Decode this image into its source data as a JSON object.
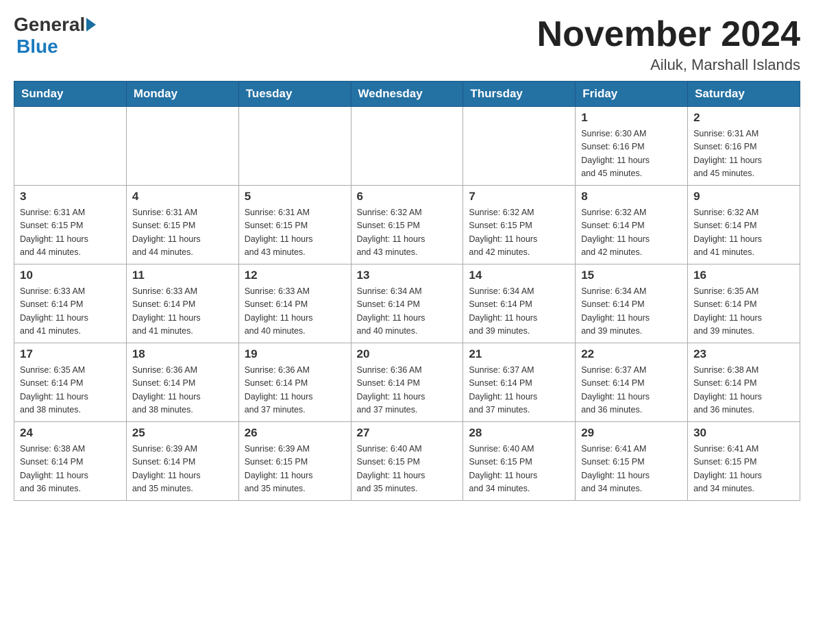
{
  "header": {
    "logo": {
      "general": "General",
      "blue": "Blue"
    },
    "title": "November 2024",
    "location": "Ailuk, Marshall Islands"
  },
  "weekdays": [
    "Sunday",
    "Monday",
    "Tuesday",
    "Wednesday",
    "Thursday",
    "Friday",
    "Saturday"
  ],
  "weeks": [
    [
      {
        "day": "",
        "info": ""
      },
      {
        "day": "",
        "info": ""
      },
      {
        "day": "",
        "info": ""
      },
      {
        "day": "",
        "info": ""
      },
      {
        "day": "",
        "info": ""
      },
      {
        "day": "1",
        "info": "Sunrise: 6:30 AM\nSunset: 6:16 PM\nDaylight: 11 hours\nand 45 minutes."
      },
      {
        "day": "2",
        "info": "Sunrise: 6:31 AM\nSunset: 6:16 PM\nDaylight: 11 hours\nand 45 minutes."
      }
    ],
    [
      {
        "day": "3",
        "info": "Sunrise: 6:31 AM\nSunset: 6:15 PM\nDaylight: 11 hours\nand 44 minutes."
      },
      {
        "day": "4",
        "info": "Sunrise: 6:31 AM\nSunset: 6:15 PM\nDaylight: 11 hours\nand 44 minutes."
      },
      {
        "day": "5",
        "info": "Sunrise: 6:31 AM\nSunset: 6:15 PM\nDaylight: 11 hours\nand 43 minutes."
      },
      {
        "day": "6",
        "info": "Sunrise: 6:32 AM\nSunset: 6:15 PM\nDaylight: 11 hours\nand 43 minutes."
      },
      {
        "day": "7",
        "info": "Sunrise: 6:32 AM\nSunset: 6:15 PM\nDaylight: 11 hours\nand 42 minutes."
      },
      {
        "day": "8",
        "info": "Sunrise: 6:32 AM\nSunset: 6:14 PM\nDaylight: 11 hours\nand 42 minutes."
      },
      {
        "day": "9",
        "info": "Sunrise: 6:32 AM\nSunset: 6:14 PM\nDaylight: 11 hours\nand 41 minutes."
      }
    ],
    [
      {
        "day": "10",
        "info": "Sunrise: 6:33 AM\nSunset: 6:14 PM\nDaylight: 11 hours\nand 41 minutes."
      },
      {
        "day": "11",
        "info": "Sunrise: 6:33 AM\nSunset: 6:14 PM\nDaylight: 11 hours\nand 41 minutes."
      },
      {
        "day": "12",
        "info": "Sunrise: 6:33 AM\nSunset: 6:14 PM\nDaylight: 11 hours\nand 40 minutes."
      },
      {
        "day": "13",
        "info": "Sunrise: 6:34 AM\nSunset: 6:14 PM\nDaylight: 11 hours\nand 40 minutes."
      },
      {
        "day": "14",
        "info": "Sunrise: 6:34 AM\nSunset: 6:14 PM\nDaylight: 11 hours\nand 39 minutes."
      },
      {
        "day": "15",
        "info": "Sunrise: 6:34 AM\nSunset: 6:14 PM\nDaylight: 11 hours\nand 39 minutes."
      },
      {
        "day": "16",
        "info": "Sunrise: 6:35 AM\nSunset: 6:14 PM\nDaylight: 11 hours\nand 39 minutes."
      }
    ],
    [
      {
        "day": "17",
        "info": "Sunrise: 6:35 AM\nSunset: 6:14 PM\nDaylight: 11 hours\nand 38 minutes."
      },
      {
        "day": "18",
        "info": "Sunrise: 6:36 AM\nSunset: 6:14 PM\nDaylight: 11 hours\nand 38 minutes."
      },
      {
        "day": "19",
        "info": "Sunrise: 6:36 AM\nSunset: 6:14 PM\nDaylight: 11 hours\nand 37 minutes."
      },
      {
        "day": "20",
        "info": "Sunrise: 6:36 AM\nSunset: 6:14 PM\nDaylight: 11 hours\nand 37 minutes."
      },
      {
        "day": "21",
        "info": "Sunrise: 6:37 AM\nSunset: 6:14 PM\nDaylight: 11 hours\nand 37 minutes."
      },
      {
        "day": "22",
        "info": "Sunrise: 6:37 AM\nSunset: 6:14 PM\nDaylight: 11 hours\nand 36 minutes."
      },
      {
        "day": "23",
        "info": "Sunrise: 6:38 AM\nSunset: 6:14 PM\nDaylight: 11 hours\nand 36 minutes."
      }
    ],
    [
      {
        "day": "24",
        "info": "Sunrise: 6:38 AM\nSunset: 6:14 PM\nDaylight: 11 hours\nand 36 minutes."
      },
      {
        "day": "25",
        "info": "Sunrise: 6:39 AM\nSunset: 6:14 PM\nDaylight: 11 hours\nand 35 minutes."
      },
      {
        "day": "26",
        "info": "Sunrise: 6:39 AM\nSunset: 6:15 PM\nDaylight: 11 hours\nand 35 minutes."
      },
      {
        "day": "27",
        "info": "Sunrise: 6:40 AM\nSunset: 6:15 PM\nDaylight: 11 hours\nand 35 minutes."
      },
      {
        "day": "28",
        "info": "Sunrise: 6:40 AM\nSunset: 6:15 PM\nDaylight: 11 hours\nand 34 minutes."
      },
      {
        "day": "29",
        "info": "Sunrise: 6:41 AM\nSunset: 6:15 PM\nDaylight: 11 hours\nand 34 minutes."
      },
      {
        "day": "30",
        "info": "Sunrise: 6:41 AM\nSunset: 6:15 PM\nDaylight: 11 hours\nand 34 minutes."
      }
    ]
  ]
}
